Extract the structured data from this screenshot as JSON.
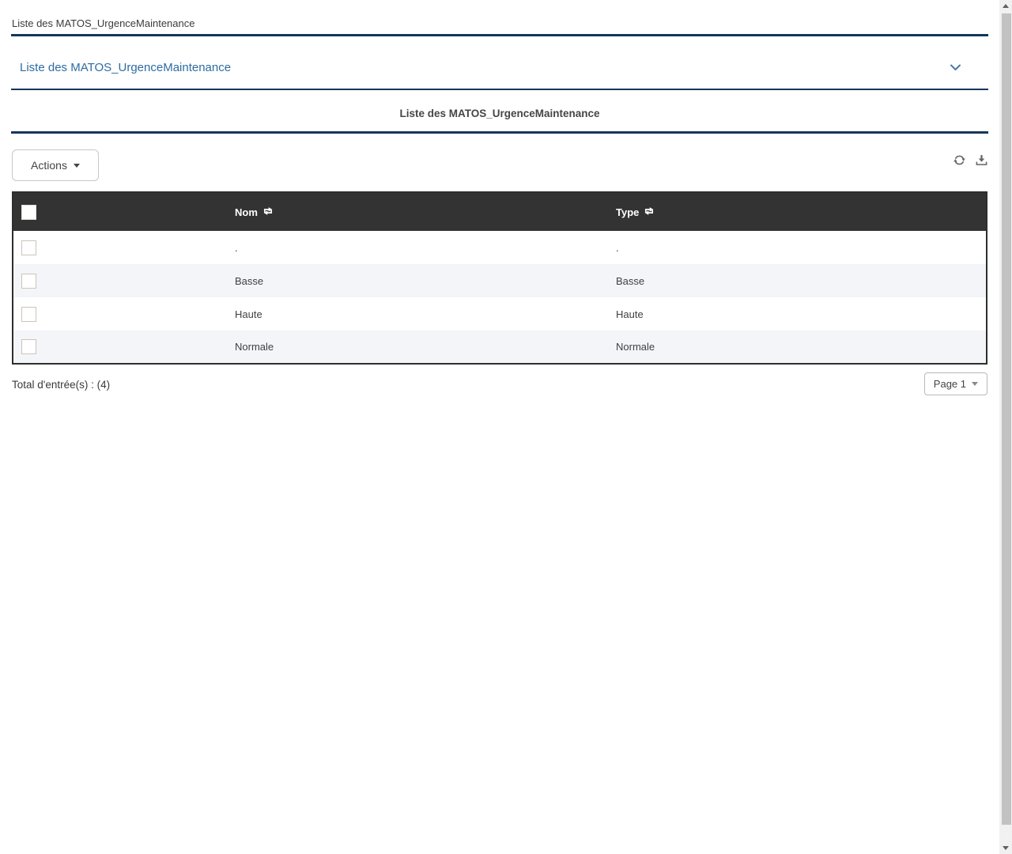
{
  "page": {
    "top_title": "Liste des MATOS_UrgenceMaintenance",
    "section_title": "Liste des MATOS_UrgenceMaintenance",
    "panel_title": "Liste des MATOS_UrgenceMaintenance"
  },
  "toolbar": {
    "actions_label": "Actions"
  },
  "table": {
    "columns": [
      {
        "label": "Nom"
      },
      {
        "label": "Type"
      }
    ],
    "rows": [
      {
        "nom": ".",
        "type": "."
      },
      {
        "nom": "Basse",
        "type": "Basse"
      },
      {
        "nom": "Haute",
        "type": "Haute"
      },
      {
        "nom": "Normale",
        "type": "Normale"
      }
    ]
  },
  "footer": {
    "total_label": "Total d'entrée(s) : (4)",
    "page_label": "Page 1"
  },
  "icons": {
    "section_chevron": "chevron-down",
    "actions_caret": "caret-down",
    "refresh": "circular-arrows",
    "download": "arrow-into-tray",
    "sort": "loop-arrows",
    "page_caret": "caret-down",
    "scroll_up": "triangle-up",
    "scroll_down": "triangle-down"
  },
  "colors": {
    "accent_navy": "#17365a",
    "link_blue": "#2d6ca2",
    "table_header_bg": "#333333",
    "row_alt_bg": "#f4f5f8",
    "checkbox_border": "#cbc5ba"
  }
}
